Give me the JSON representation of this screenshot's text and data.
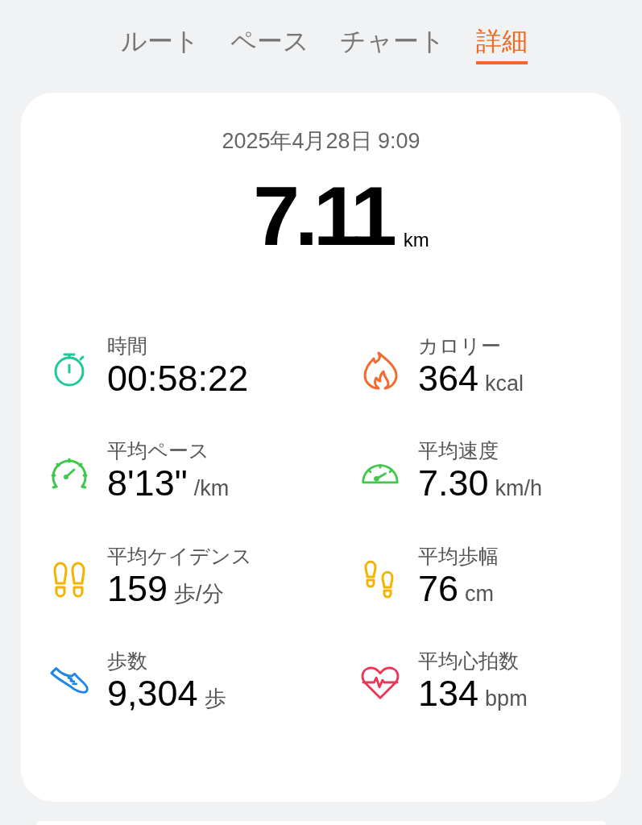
{
  "tabs": [
    {
      "label": "ルート",
      "selected": false
    },
    {
      "label": "ペース",
      "selected": false
    },
    {
      "label": "チャート",
      "selected": false
    },
    {
      "label": "詳細",
      "selected": true
    }
  ],
  "summary": {
    "date": "2025年4月28日 9:09",
    "distance": "7.11",
    "distance_unit": "km"
  },
  "stats": [
    {
      "kind": "timer",
      "label": "時間",
      "value": "00:58:22"
    },
    {
      "kind": "flame",
      "label": "カロリー",
      "value": "364",
      "unit": "kcal"
    },
    {
      "kind": "pace",
      "label": "平均ペース",
      "value": "8'13\"",
      "unit": "/km"
    },
    {
      "kind": "speed",
      "label": "平均速度",
      "value": "7.30",
      "unit": "km/h"
    },
    {
      "kind": "cadence",
      "label": "平均ケイデンス",
      "value": "159",
      "unit": "歩/分"
    },
    {
      "kind": "stride",
      "label": "平均歩幅",
      "value": "76",
      "unit": "cm"
    },
    {
      "kind": "shoe",
      "label": "歩数",
      "value": "9,304",
      "unit": "歩"
    },
    {
      "kind": "heart",
      "label": "平均心拍数",
      "value": "134",
      "unit": "bpm"
    }
  ]
}
